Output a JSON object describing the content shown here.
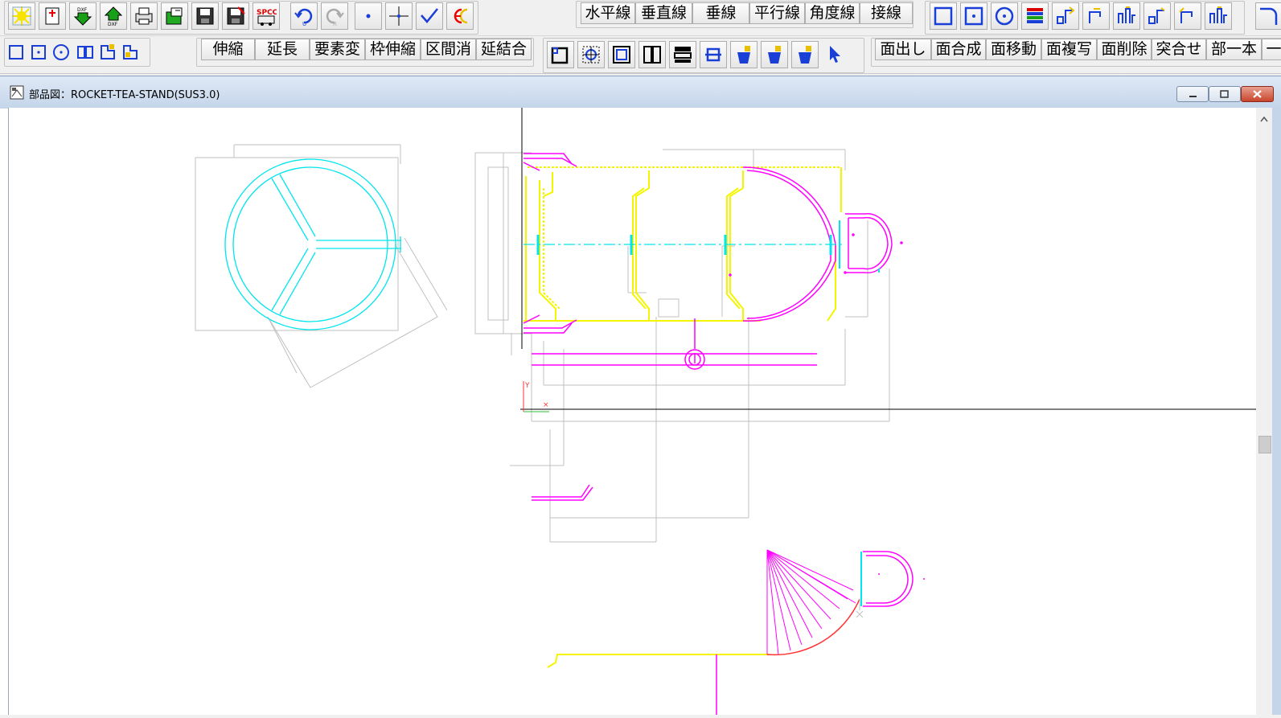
{
  "window": {
    "title": "部品図：ROCKET-TEA-STAND(SUS3.0)"
  },
  "toolbar1": {
    "icon_buttons": [
      {
        "name": "new-icon"
      },
      {
        "name": "new-page-icon"
      },
      {
        "name": "dxf-import-icon"
      },
      {
        "name": "dxf-export-icon"
      },
      {
        "name": "print-icon"
      },
      {
        "name": "open-icon"
      },
      {
        "name": "save-icon"
      },
      {
        "name": "save-as-icon"
      },
      {
        "name": "spcc-icon"
      },
      {
        "name": "undo-icon"
      },
      {
        "name": "redo-icon"
      },
      {
        "name": "point-icon"
      },
      {
        "name": "cross-point-icon"
      },
      {
        "name": "check-icon"
      },
      {
        "name": "ec-icon"
      }
    ],
    "spcc_label": "SPCC",
    "text_buttons": [
      "水平線",
      "垂直線",
      "垂線",
      "平行線",
      "角度線",
      "接線"
    ],
    "shape_buttons": [
      {
        "name": "rectangle-icon"
      },
      {
        "name": "rect-center-icon"
      },
      {
        "name": "circle-icon"
      },
      {
        "name": "layers-icon"
      },
      {
        "name": "bend-up-icon"
      },
      {
        "name": "bend-up2-icon"
      },
      {
        "name": "bend-channel-icon"
      },
      {
        "name": "bend-up3-icon"
      },
      {
        "name": "bend-up4-icon"
      },
      {
        "name": "bend-channel2-icon"
      },
      {
        "name": "hook-icon"
      }
    ]
  },
  "toolbar2": {
    "small_icons": [
      {
        "name": "small-rect-icon"
      },
      {
        "name": "small-rect-center-icon"
      },
      {
        "name": "small-circle-icon"
      },
      {
        "name": "small-double-rect-icon"
      },
      {
        "name": "small-split-icon"
      },
      {
        "name": "small-split2-icon"
      }
    ],
    "edit_buttons": [
      "伸縮",
      "延長",
      "要素変",
      "枠伸縮",
      "区間消",
      "延結合"
    ],
    "view_buttons": [
      {
        "name": "zoom-window-icon"
      },
      {
        "name": "zoom-target-icon"
      },
      {
        "name": "zoom-fit-icon"
      },
      {
        "name": "split-vertical-icon"
      },
      {
        "name": "split-horizontal-icon"
      },
      {
        "name": "bracket-icon"
      },
      {
        "name": "bucket-icon"
      },
      {
        "name": "bucket2-icon"
      },
      {
        "name": "bucket3-icon"
      },
      {
        "name": "cursor-icon"
      }
    ],
    "face_buttons": [
      "面出し",
      "面合成",
      "面移動",
      "面複写",
      "面削除",
      "突合せ",
      "部一本",
      "一"
    ]
  },
  "colors": {
    "cyan": "#00e5ee",
    "magenta": "#ff00ff",
    "yellow": "#f5f500",
    "gray": "#c0c0c0",
    "black": "#000000",
    "red": "#ff3030"
  }
}
